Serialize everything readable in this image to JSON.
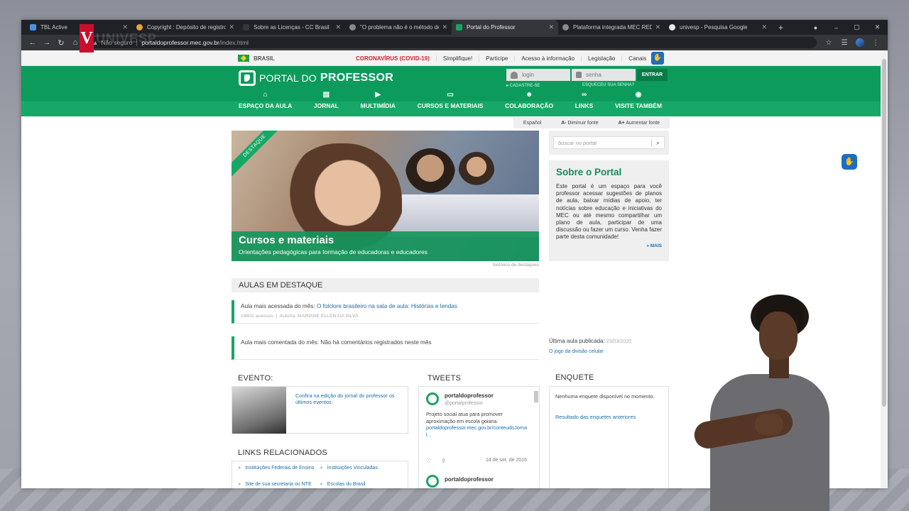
{
  "overlay": {
    "logo_letter": "V",
    "logo_text": "UNIVESP"
  },
  "browser": {
    "tabs": [
      {
        "title": "TBL Active",
        "color": "#4a90e2"
      },
      {
        "title": "Copyright : Depósito de registro",
        "color": "#e2a53a"
      },
      {
        "title": "Sobre as Licenças - CC Brasil",
        "color": "#35363a"
      },
      {
        "title": "\"O problema não é o método de",
        "color": "#8a8a8a"
      },
      {
        "title": "Portal do Professor",
        "color": "#1aa365"
      },
      {
        "title": "Plataforma integrada MEC RED",
        "color": "#8a8a8a"
      },
      {
        "title": "univesp - Pesquisa Google",
        "color": "#e8eaed"
      }
    ],
    "new_tab": "+",
    "window_controls": [
      "–",
      "▢",
      "✕"
    ],
    "nav": {
      "back": "←",
      "forward": "→",
      "reload": "↻",
      "home": "⌂"
    },
    "address": {
      "security": "Não seguro",
      "host": "portaldoprofessor.mec.gov.br",
      "path": "/index.html"
    },
    "right_icons": {
      "star": "☆",
      "media": "☰",
      "menu": "⋮"
    }
  },
  "gov_bar": {
    "brasil": "BRASIL",
    "links": [
      "CORONAVÍRUS (COVID-19)",
      "Simplifique!",
      "Participe",
      "Acesso à informação",
      "Legislação",
      "Canais"
    ],
    "access_icon": "✋"
  },
  "header": {
    "logo_part1": "PORTAL DO",
    "logo_part2": "PROFESSOR",
    "login_placeholder": "login",
    "password_placeholder": "senha",
    "login_button": "ENTRAR",
    "register_link": "▸ CADASTRE-SE",
    "forgot_link": "ESQUECEU SUA SENHA?",
    "menu": [
      {
        "icon": "⌂",
        "label": "ESPAÇO DA AULA"
      },
      {
        "icon": "▤",
        "label": "JORNAL"
      },
      {
        "icon": "▶",
        "label": "MULTIMÍDIA"
      },
      {
        "icon": "▭",
        "label": "CURSOS E MATERIAIS"
      },
      {
        "icon": "☻",
        "label": "COLABORAÇÃO"
      },
      {
        "icon": "∞",
        "label": "LINKS"
      },
      {
        "icon": "◉",
        "label": "VISITE TAMBÉM"
      }
    ]
  },
  "tools": {
    "lang": "Español",
    "decrease": "Diminuir fonte",
    "increase": "Aumentar fonte",
    "a_minus": "A-",
    "a_plus": "A+"
  },
  "hero": {
    "ribbon": "DESTAQUE",
    "title": "Cursos e materiais",
    "subtitle": "Orientações pedagógicas para formação de educadoras e educadores",
    "history": "histórico de destaques"
  },
  "search": {
    "placeholder": "buscar no portal",
    "icon": "⌕"
  },
  "sobre": {
    "title": "Sobre o Portal",
    "text": "Este portal é um espaço para você professor acessar sugestões de planos de aula, baixar mídias de apoio, ter notícias sobre educação e iniciativas do MEC ou até mesmo compartilhar um plano de aula, participar de uma discussão ou fazer um curso. Venha fazer parte desta comunidade!",
    "more": "» MAIS"
  },
  "aulas": {
    "title": "AULAS EM DESTAQUE",
    "most_accessed_label": "Aula mais acessada do mês:",
    "most_accessed_link": "O folclore brasileiro na sala de aula: Histórias e lendas",
    "accesses": "19802 acessos",
    "author": "Autoria: MARIANE ELLEN DA SILVA",
    "most_commented_label": "Aula mais comentada do mês:",
    "most_commented_value": "Não há comentários registrados neste mês",
    "last_published_label": "Última aula publicada:",
    "last_published_date": "23/03/2020",
    "last_published_link": "O jogo da divisão celular"
  },
  "evento": {
    "title": "EVENTO:",
    "text": "Confira na edição do jornal do professor os últimos eventos."
  },
  "tweets": {
    "title": "TWEETS",
    "name": "portaldoprofessor",
    "handle": "@portalprofessor",
    "text": "Projeto social atua para promover aproximação em escola goiana.",
    "link": "portaldoprofessor.mec.gov.br/conteudoJornal...",
    "like": "♡",
    "share": "⇪",
    "date": "14 de set. de 2016",
    "name2": "portaldoprofessor"
  },
  "enquete": {
    "title": "ENQUETE",
    "empty": "Nenhuma enquete disponível no momento.",
    "results": "Resultado das enquetes anteriores"
  },
  "links": {
    "title": "LINKS RELACIONADOS",
    "items": [
      "Instituições Federais de Ensino",
      "Instituições Vinculadas",
      "Site de sua secretaria ou NTE",
      "Escolas do Brasil"
    ]
  },
  "float_access": "✋"
}
